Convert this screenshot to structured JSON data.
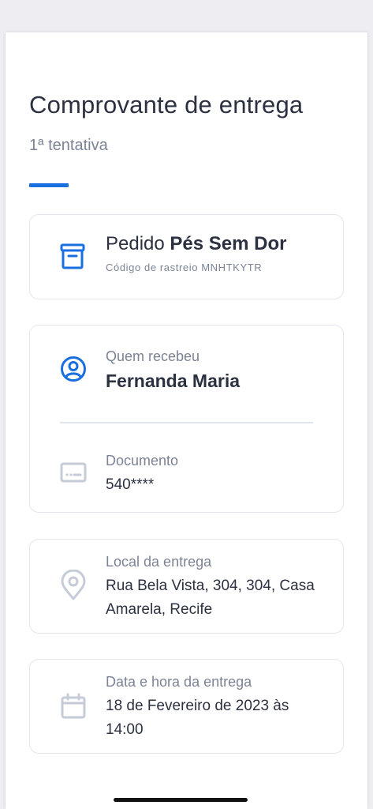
{
  "page": {
    "title": "Comprovante de entrega",
    "subtitle": "1ª tentativa"
  },
  "order": {
    "prefix": "Pedido",
    "name": "Pés Sem Dor",
    "tracking": "Código de rastreio MNHTKYTR",
    "icon": "archive-box-icon"
  },
  "receiver": {
    "label": "Quem recebeu",
    "name": "Fernanda Maria",
    "icon": "user-circle-icon"
  },
  "document": {
    "label": "Documento",
    "value": "540****",
    "icon": "id-card-icon"
  },
  "location": {
    "label": "Local da entrega",
    "line1": "Rua Bela Vista, 304, 304, Casa",
    "line2": "Amarela, Recife",
    "icon": "location-pin-icon"
  },
  "datetime": {
    "label": "Data e hora da entrega",
    "line1": "18 de Fevereiro de 2023 às",
    "line2": "14:00",
    "icon": "calendar-icon"
  },
  "colors": {
    "accent": "#1a6fe0",
    "muted_icon": "#c5ccd8",
    "text": "#2b3140",
    "muted_text": "#7b8394"
  }
}
